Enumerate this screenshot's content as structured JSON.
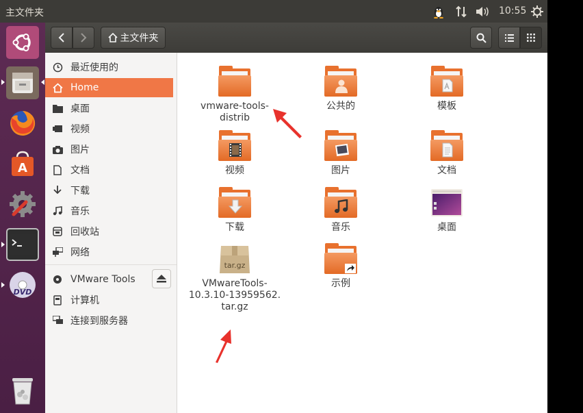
{
  "window": {
    "title": "主文件夹"
  },
  "panel": {
    "clock": "10:55"
  },
  "launcher": {
    "items": [
      {
        "name": "ubuntu-dash"
      },
      {
        "name": "files"
      },
      {
        "name": "firefox"
      },
      {
        "name": "software-center"
      },
      {
        "name": "system-settings"
      },
      {
        "name": "terminal"
      },
      {
        "name": "dvd"
      },
      {
        "name": "trash"
      }
    ]
  },
  "header": {
    "path": "主文件夹"
  },
  "sidebar": {
    "items": [
      {
        "label": "最近使用的",
        "icon": "clock-icon"
      },
      {
        "label": "Home",
        "icon": "home-icon",
        "active": true
      },
      {
        "label": "桌面",
        "icon": "folder-icon"
      },
      {
        "label": "视频",
        "icon": "video-icon"
      },
      {
        "label": "图片",
        "icon": "camera-icon"
      },
      {
        "label": "文档",
        "icon": "document-icon"
      },
      {
        "label": "下载",
        "icon": "download-icon"
      },
      {
        "label": "音乐",
        "icon": "music-icon"
      },
      {
        "label": "回收站",
        "icon": "trash-icon"
      },
      {
        "label": "网络",
        "icon": "network-icon"
      },
      {
        "label": "VMware Tools",
        "icon": "disc-icon"
      },
      {
        "label": "计算机",
        "icon": "drive-icon"
      },
      {
        "label": "连接到服务器",
        "icon": "server-icon"
      }
    ]
  },
  "files": [
    {
      "name": "vmware-tools-distrib",
      "label_lines": [
        "vmware-tools-",
        "distrib"
      ],
      "type": "folder"
    },
    {
      "name": "公共的",
      "label_lines": [
        "公共的"
      ],
      "type": "folder-public"
    },
    {
      "name": "模板",
      "label_lines": [
        "模板"
      ],
      "type": "folder-templates"
    },
    {
      "name": "视频",
      "label_lines": [
        "视频"
      ],
      "type": "folder-videos"
    },
    {
      "name": "图片",
      "label_lines": [
        "图片"
      ],
      "type": "folder-pictures"
    },
    {
      "name": "文档",
      "label_lines": [
        "文档"
      ],
      "type": "folder-documents"
    },
    {
      "name": "下载",
      "label_lines": [
        "下载"
      ],
      "type": "folder-downloads"
    },
    {
      "name": "音乐",
      "label_lines": [
        "音乐"
      ],
      "type": "folder-music"
    },
    {
      "name": "桌面",
      "label_lines": [
        "桌面"
      ],
      "type": "folder-desktop"
    },
    {
      "name": "VMwareTools-10.3.10-13959562.tar.gz",
      "label_lines": [
        "VMwareTools-",
        "10.3.10-13959562.",
        "tar.gz"
      ],
      "type": "archive",
      "icon_text": "tar.gz"
    },
    {
      "name": "示例",
      "label_lines": [
        "示例"
      ],
      "type": "folder-link"
    }
  ],
  "colors": {
    "accent": "#f07746",
    "panel": "#3c3b37",
    "launcher": "#5d2b53",
    "annotation": "#e8322c"
  }
}
